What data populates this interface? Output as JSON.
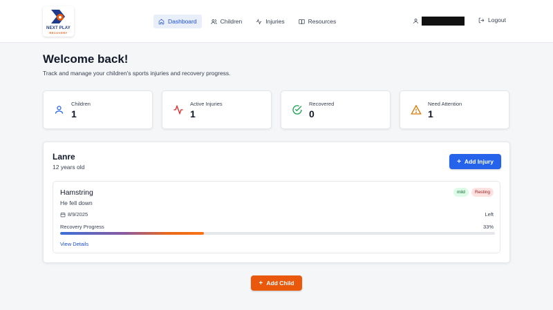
{
  "brand": {
    "line1": "NEXT PLAY",
    "line2": "RECOVERY"
  },
  "nav": {
    "items": [
      {
        "label": "Dashboard",
        "icon": "home-icon"
      },
      {
        "label": "Children",
        "icon": "users-icon"
      },
      {
        "label": "Injuries",
        "icon": "activity-icon"
      },
      {
        "label": "Resources",
        "icon": "book-icon"
      }
    ],
    "active_index": 0
  },
  "user": {
    "icon": "user-icon",
    "name_redacted": true
  },
  "logout": {
    "label": "Logout",
    "icon": "logout-icon"
  },
  "welcome": {
    "title": "Welcome back!",
    "subtitle": "Track and manage your children's sports injuries and recovery progress."
  },
  "stats": [
    {
      "label": "Children",
      "value": "1",
      "icon": "user-icon",
      "color": "#2563eb"
    },
    {
      "label": "Active Injuries",
      "value": "1",
      "icon": "activity-icon",
      "color": "#dc2626"
    },
    {
      "label": "Recovered",
      "value": "0",
      "icon": "check-circle-icon",
      "color": "#16a34a"
    },
    {
      "label": "Need Attention",
      "value": "1",
      "icon": "alert-triangle-icon",
      "color": "#d97706"
    }
  ],
  "child": {
    "name": "Lanre",
    "age": "12 years old",
    "add_injury_label": "Add Injury",
    "injury": {
      "name": "Hamstring",
      "description": "He fell down",
      "severity": "mild",
      "status": "Resting",
      "date": "8/9/2025",
      "side": "Left",
      "progress_label": "Recovery Progress",
      "progress_text": "33%",
      "progress_fraction": 0.33,
      "view_details_label": "View Details"
    }
  },
  "add_child_label": "Add Child",
  "colors": {
    "primary": "#2563eb",
    "accent": "#ea580c"
  }
}
